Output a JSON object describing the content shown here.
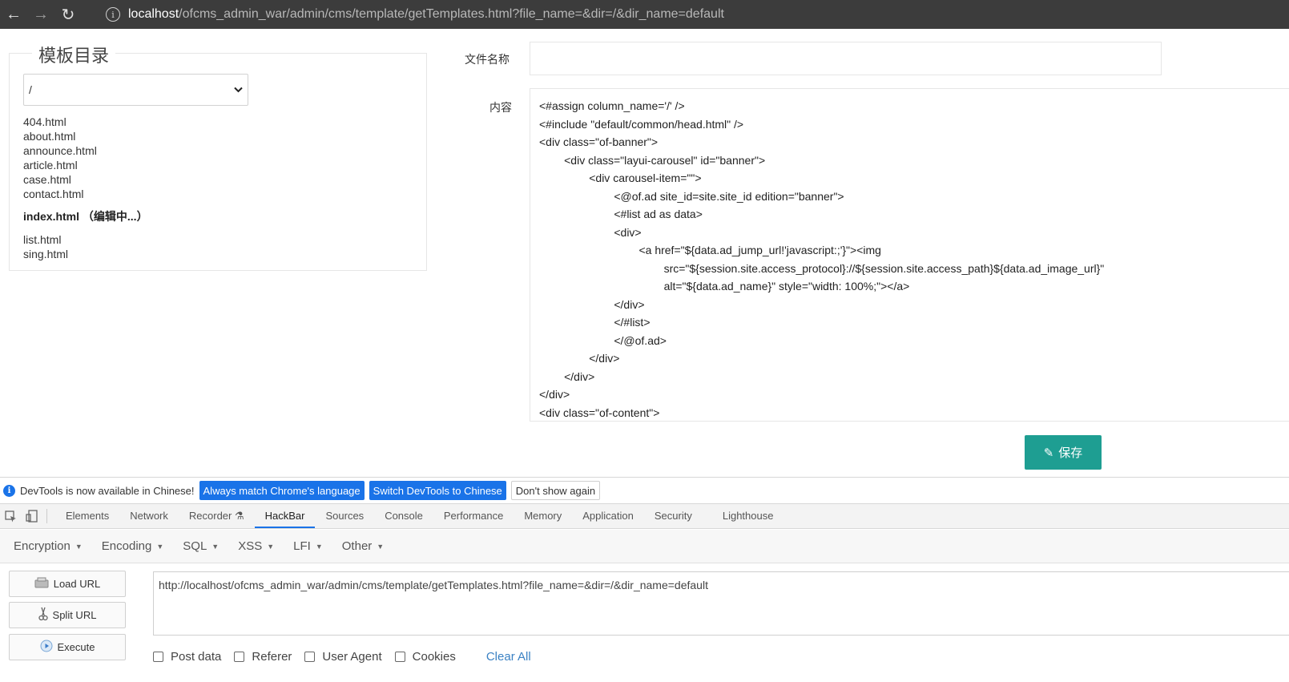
{
  "browser": {
    "back_icon": "←",
    "forward_icon": "→",
    "reload_icon": "↻",
    "info_icon": "i",
    "url_host": "localhost",
    "url_path": "/ofcms_admin_war/admin/cms/template/getTemplates.html?file_name=&dir=/&dir_name=default"
  },
  "template_panel": {
    "title": "模板目录",
    "dir_select_value": "/",
    "files": [
      "404.html",
      "about.html",
      "announce.html",
      "article.html",
      "case.html",
      "contact.html"
    ],
    "active_file": "index.html （编辑中...）",
    "files_after": [
      "list.html",
      "sing.html"
    ]
  },
  "form": {
    "filename_label": "文件名称",
    "filename_value": "",
    "content_label": "内容",
    "code_lines": [
      "<#assign column_name='/' />",
      "<#include \"default/common/head.html\" />",
      "<div class=\"of-banner\">",
      "        <div class=\"layui-carousel\" id=\"banner\">",
      "                <div carousel-item=\"\">",
      "                        <@of.ad site_id=site.site_id edition=\"banner\">",
      "                        <#list ad as data>",
      "                        <div>",
      "                                <a href=\"${data.ad_jump_url!'javascript:;'}\"><img",
      "                                        src=\"${session.site.access_protocol}://${session.site.access_path}${data.ad_image_url}\"",
      "                                        alt=\"${data.ad_name}\" style=\"width: 100%;\"></a>",
      "                        </div>",
      "                        </#list>",
      "                        </@of.ad>",
      "                </div>",
      "        </div>",
      "</div>",
      "<div class=\"of-content\">"
    ],
    "save_label": "保存",
    "save_icon": "✎"
  },
  "devtools_notice": {
    "message": "DevTools is now available in Chinese!",
    "btn_match": "Always match Chrome's language",
    "btn_switch": "Switch DevTools to Chinese",
    "btn_dismiss": "Don't show again"
  },
  "devtools_tabs": [
    "Elements",
    "Network",
    "Recorder ⚗",
    "HackBar",
    "Sources",
    "Console",
    "Performance",
    "Memory",
    "Application",
    "Security",
    "Lighthouse"
  ],
  "devtools_active_tab": "HackBar",
  "hackbar": {
    "menus": [
      "Encryption",
      "Encoding",
      "SQL",
      "XSS",
      "LFI",
      "Other"
    ],
    "load_url": "Load URL",
    "split_url": "Split URL",
    "execute": "Execute",
    "url_value": "http://localhost/ofcms_admin_war/admin/cms/template/getTemplates.html?file_name=&dir=/&dir_name=default",
    "checks": [
      "Post data",
      "Referer",
      "User Agent",
      "Cookies"
    ],
    "clear_all": "Clear All"
  }
}
